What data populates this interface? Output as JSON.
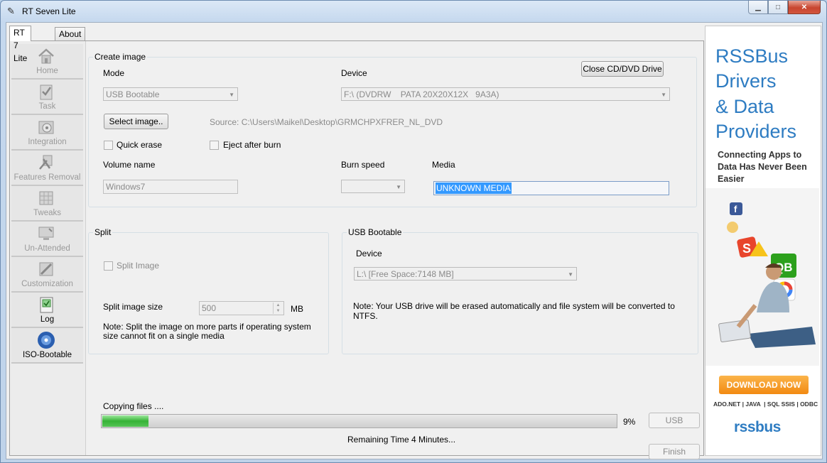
{
  "window": {
    "title": "RT Seven Lite"
  },
  "tabs": [
    {
      "label": "RT 7 Lite"
    },
    {
      "label": "About"
    }
  ],
  "sidebar": {
    "items": [
      {
        "label": "Home",
        "icon": "home-icon"
      },
      {
        "label": "Task",
        "icon": "task-icon"
      },
      {
        "label": "Integration",
        "icon": "integration-icon"
      },
      {
        "label": "Features Removal",
        "icon": "features-removal-icon"
      },
      {
        "label": "Tweaks",
        "icon": "tweaks-icon"
      },
      {
        "label": "Un-Attended",
        "icon": "unattended-icon"
      },
      {
        "label": "Customization",
        "icon": "customization-icon"
      },
      {
        "label": "Log",
        "icon": "log-icon"
      },
      {
        "label": "ISO-Bootable",
        "icon": "iso-bootable-icon"
      }
    ]
  },
  "create_image": {
    "title": "Create image",
    "mode_label": "Mode",
    "mode_value": "USB Bootable",
    "device_label": "Device",
    "device_value": "F:\\ (DVDRW    PATA 20X20X12X   9A3A)",
    "close_drive_button": "Close CD/DVD Drive",
    "select_image_button": "Select image..",
    "source_text": "Source: C:\\Users\\Maikel\\Desktop\\GRMCHPXFRER_NL_DVD",
    "quick_erase_label": "Quick erase",
    "eject_label": "Eject after burn",
    "volume_label": "Volume name",
    "volume_value": "Windows7",
    "burn_speed_label": "Burn speed",
    "media_label": "Media",
    "media_value": "UNKNOWN MEDIA"
  },
  "split": {
    "title": "Split",
    "split_image_label": "Split Image",
    "size_label": "Split image size",
    "size_value": "500",
    "size_unit": "MB",
    "note": "Note: Split the image on more parts if operating system size cannot fit on a single media"
  },
  "usb_bootable": {
    "title": "USB Bootable",
    "device_label": "Device",
    "device_value": "L:\\ [Free Space:7148 MB]",
    "note": "Note: Your USB drive will be erased automatically and file system will be converted to NTFS."
  },
  "progress": {
    "status": "Copying files ....",
    "percent": 9,
    "percent_text": "9%",
    "remaining": "Remaining Time 4 Minutes...",
    "usb_button": "USB",
    "finish_button": "Finish"
  },
  "ad": {
    "headline": [
      "RSSBus",
      "Drivers",
      "& Data",
      "Providers"
    ],
    "subline": "Connecting Apps to Data Has Never Been Easier",
    "download_button": "DOWNLOAD NOW",
    "footer": "ADO.NET | JAVA  | SQL SSIS | ODBC",
    "logo": "rssbus",
    "colors": {
      "brand_blue": "#2e7cc2",
      "download_orange": "#f28a12"
    }
  }
}
